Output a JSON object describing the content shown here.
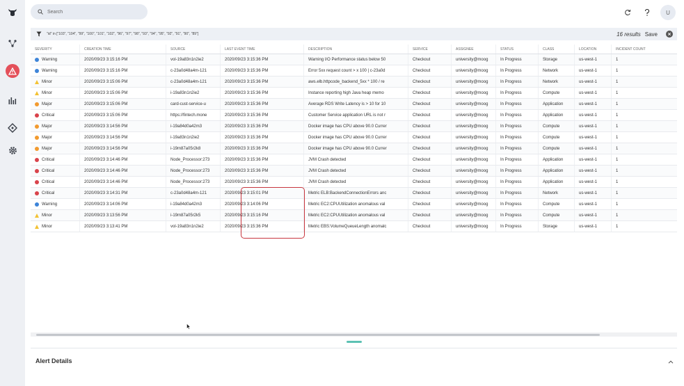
{
  "search": {
    "placeholder": "Search"
  },
  "topbar": {
    "avatar": "U"
  },
  "filter": {
    "text": "\"id\" in [\"103\", \"104\", \"99\", \"100\", \"101\", \"102\", \"96\", \"97\", \"98\", \"93\", \"94\", \"95\", \"92\", \"91\", \"90\", \"89\"]",
    "results": "16 results",
    "save_label": "Save"
  },
  "table": {
    "columns": [
      "Severity",
      "Creation Time",
      "Source",
      "Last Event Time",
      "Description",
      "Service",
      "Assignee",
      "Status",
      "Class",
      "Location",
      "Incident Count"
    ],
    "rows": [
      [
        "Warning",
        "2020/09/23 3:15:16 PM",
        "vol-19a83n1n2ie2",
        "2020/09/23 3:15:36 PM",
        "Warning I/O Performance status below 50",
        "Checkout",
        "university@moog",
        "In Progress",
        "Storage",
        "us-west-1",
        "1"
      ],
      [
        "Warning",
        "2020/09/23 3:15:16 PM",
        "c-23a0d48a4m-121",
        "2020/09/23 3:15:36 PM",
        "Error 5xx request count > x 100 | c-23a0d",
        "Checkout",
        "university@moog",
        "In Progress",
        "Network",
        "us-west-1",
        "1"
      ],
      [
        "Minor",
        "2020/09/23 3:15:06 PM",
        "c-23a0d48a4m-121",
        "2020/09/23 3:15:36 PM",
        "aws.elb.httpcode_backend_5xx * 100 / re",
        "Checkout",
        "university@moog",
        "In Progress",
        "Network",
        "us-west-1",
        "1"
      ],
      [
        "Minor",
        "2020/09/23 3:15:06 PM",
        "i-19a83n1n2ie2",
        "2020/09/23 3:15:36 PM",
        "Instance reporting high Java heap memo",
        "Checkout",
        "university@moog",
        "In Progress",
        "Compute",
        "us-west-1",
        "1"
      ],
      [
        "Major",
        "2020/09/23 3:15:06 PM",
        "card-cust-service-u",
        "2020/09/23 3:15:36 PM",
        "Average RDS Write Latency is > 10 for 10",
        "Checkout",
        "university@moog",
        "In Progress",
        "Application",
        "us-west-1",
        "1"
      ],
      [
        "Critical",
        "2020/09/23 3:15:06 PM",
        "https://fintech.mone",
        "2020/09/23 3:15:36 PM",
        "Customer Service application URL is not r",
        "Checkout",
        "university@moog",
        "In Progress",
        "Application",
        "us-west-1",
        "1"
      ],
      [
        "Major",
        "2020/09/23 3:14:56 PM",
        "i-19a84d0a42m3",
        "2020/09/23 3:15:36 PM",
        "Docker image has CPU above 90.0 Currer",
        "Checkout",
        "university@moog",
        "In Progress",
        "Compute",
        "us-west-1",
        "1"
      ],
      [
        "Major",
        "2020/09/23 3:14:56 PM",
        "i-19a83n1n2ie2",
        "2020/09/23 3:15:36 PM",
        "Docker image has CPU above 90.0 Currer",
        "Checkout",
        "university@moog",
        "In Progress",
        "Compute",
        "us-west-1",
        "1"
      ],
      [
        "Major",
        "2020/09/23 3:14:56 PM",
        "i-19m87a05r2k8",
        "2020/09/23 3:15:36 PM",
        "Docker image has CPU above 90.0 Currer",
        "Checkout",
        "university@moog",
        "In Progress",
        "Compute",
        "us-west-1",
        "1"
      ],
      [
        "Critical",
        "2020/09/23 3:14:46 PM",
        "Node_Processor:273",
        "2020/09/23 3:15:36 PM",
        "JVM Crash detected",
        "Checkout",
        "university@moog",
        "In Progress",
        "Application",
        "us-west-1",
        "1"
      ],
      [
        "Critical",
        "2020/09/23 3:14:46 PM",
        "Node_Processor:273",
        "2020/09/23 3:15:36 PM",
        "JVM Crash detected",
        "Checkout",
        "university@moog",
        "In Progress",
        "Application",
        "us-west-1",
        "1"
      ],
      [
        "Critical",
        "2020/09/23 3:14:46 PM",
        "Node_Processor:273",
        "2020/09/23 3:15:36 PM",
        "JVM Crash detected",
        "Checkout",
        "university@moog",
        "In Progress",
        "Application",
        "us-west-1",
        "1"
      ],
      [
        "Critical",
        "2020/09/23 3:14:31 PM",
        "c-23a0d48a4m-121",
        "2020/09/23 3:15:01 PM",
        "Metric ELB:BackendConnectionErrors anc",
        "Checkout",
        "university@moog",
        "In Progress",
        "Network",
        "us-west-1",
        "1"
      ],
      [
        "Warning",
        "2020/09/23 3:14:06 PM",
        "i-19a84d0a42m3",
        "2020/09/23 3:14:06 PM",
        "Metric EC2:CPUUtilization anomalous val",
        "Checkout",
        "university@moog",
        "In Progress",
        "Compute",
        "us-west-1",
        "1"
      ],
      [
        "Minor",
        "2020/09/23 3:13:56 PM",
        "i-19m87a05r2k5",
        "2020/09/23 3:15:16 PM",
        "Metric EC2:CPUUtilization anomalous val",
        "Checkout",
        "university@moog",
        "In Progress",
        "Compute",
        "us-west-1",
        "1"
      ],
      [
        "Minor",
        "2020/09/23 3:13:41 PM",
        "vol-19a83n1n2ie2",
        "2020/09/23 3:15:36 PM",
        "Metric EBS:VolumeQueueLength anomalc",
        "Checkout",
        "university@moog",
        "In Progress",
        "Storage",
        "us-west-1",
        "1"
      ]
    ]
  },
  "severity_colors": {
    "Warning": "#3d84d8",
    "Minor": "#f3c233",
    "Major": "#f29a2e",
    "Critical": "#d9434b"
  },
  "details": {
    "title": "Alert Details"
  }
}
